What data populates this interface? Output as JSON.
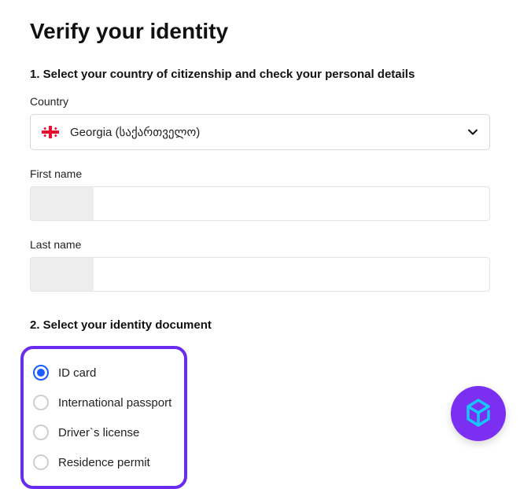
{
  "title": "Verify your identity",
  "section1": {
    "heading": "1. Select your country of citizenship and check your personal details",
    "country_label": "Country",
    "country_value": "Georgia (საქართველო)",
    "firstname_label": "First name",
    "firstname_value": "",
    "lastname_label": "Last name",
    "lastname_value": ""
  },
  "section2": {
    "heading": "2. Select your identity document",
    "options": {
      "0": {
        "label": "ID card",
        "selected": true
      },
      "1": {
        "label": "International passport",
        "selected": false
      },
      "2": {
        "label": "Driver`s license",
        "selected": false
      },
      "3": {
        "label": "Residence permit",
        "selected": false
      }
    }
  },
  "icons": {
    "flag": "georgia-flag-icon",
    "chevron": "chevron-down-icon",
    "fab": "help-logo-icon"
  }
}
